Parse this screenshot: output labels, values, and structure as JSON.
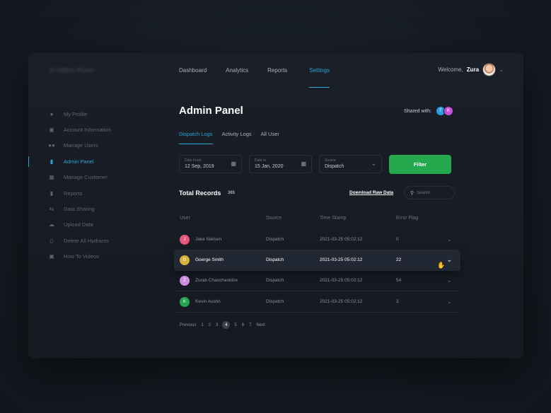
{
  "brand": {
    "name": "UI Admin Panel"
  },
  "nav": [
    {
      "label": "Dashboard"
    },
    {
      "label": "Analytics"
    },
    {
      "label": "Reports"
    },
    {
      "label": "Settings"
    }
  ],
  "welcome": {
    "prefix": "Welcome,",
    "name": "Zura"
  },
  "sidebar": [
    {
      "label": "My Profile",
      "icon": "user-icon"
    },
    {
      "label": "Account Information",
      "icon": "id-card-icon"
    },
    {
      "label": "Manage Users",
      "icon": "users-icon"
    },
    {
      "label": "Admin Panel",
      "icon": "document-icon"
    },
    {
      "label": "Manage Customer",
      "icon": "grid-icon"
    },
    {
      "label": "Reports",
      "icon": "report-icon"
    },
    {
      "label": "Data Sharing",
      "icon": "transfer-icon"
    },
    {
      "label": "Upload Data",
      "icon": "cloud-upload-icon"
    },
    {
      "label": "Delete All Hydrants",
      "icon": "trash-icon"
    },
    {
      "label": "How To Videos",
      "icon": "video-icon"
    }
  ],
  "page": {
    "title": "Admin Panel",
    "shared_label": "Shared with:"
  },
  "shared_users": [
    {
      "initial": "T",
      "color": "#2e9be0"
    },
    {
      "initial": "K",
      "color": "#c94fd6"
    }
  ],
  "tabs": [
    {
      "label": "Dispatch Logs"
    },
    {
      "label": "Activity Logs"
    },
    {
      "label": "All User"
    }
  ],
  "filters": {
    "date_from": {
      "label": "Date From",
      "value": "12 Sep, 2019"
    },
    "date_to": {
      "label": "Date to",
      "value": "15 Jan, 2020"
    },
    "source": {
      "label": "Source",
      "value": "Dispatch"
    },
    "button": "Filter"
  },
  "records": {
    "title": "Total Records",
    "count": "365",
    "download": "Download Raw Data",
    "search_placeholder": "Search"
  },
  "table": {
    "headers": [
      "User",
      "Source",
      "Time Stamp",
      "Error Flag"
    ],
    "rows": [
      {
        "initial": "J",
        "color": "#e8567a",
        "user": "Jake Nielsen",
        "source": "Dispatch",
        "time": "2021-03-25 05:02:12",
        "error": "0"
      },
      {
        "initial": "G",
        "color": "#d6b23a",
        "user": "Goerge Smith",
        "source": "Dispatch",
        "time": "2021-03-25 05:02:12",
        "error": "22"
      },
      {
        "initial": "Z",
        "color": "#c98ee0",
        "user": "Zurab Chavchanidze",
        "source": "Dispatch",
        "time": "2021-03-25 05:02:12",
        "error": "54"
      },
      {
        "initial": "K",
        "color": "#27a352",
        "user": "Kevin Austin",
        "source": "Dispatch",
        "time": "2021-03-25 05:02:12",
        "error": "3"
      }
    ]
  },
  "pagination": {
    "prev": "Previous",
    "pages": [
      "1",
      "2",
      "3",
      "4",
      "5",
      "6",
      "7"
    ],
    "current": "4",
    "next": "Next"
  },
  "colors": {
    "accent": "#2ea3d6",
    "filter_button": "#25a94f"
  }
}
